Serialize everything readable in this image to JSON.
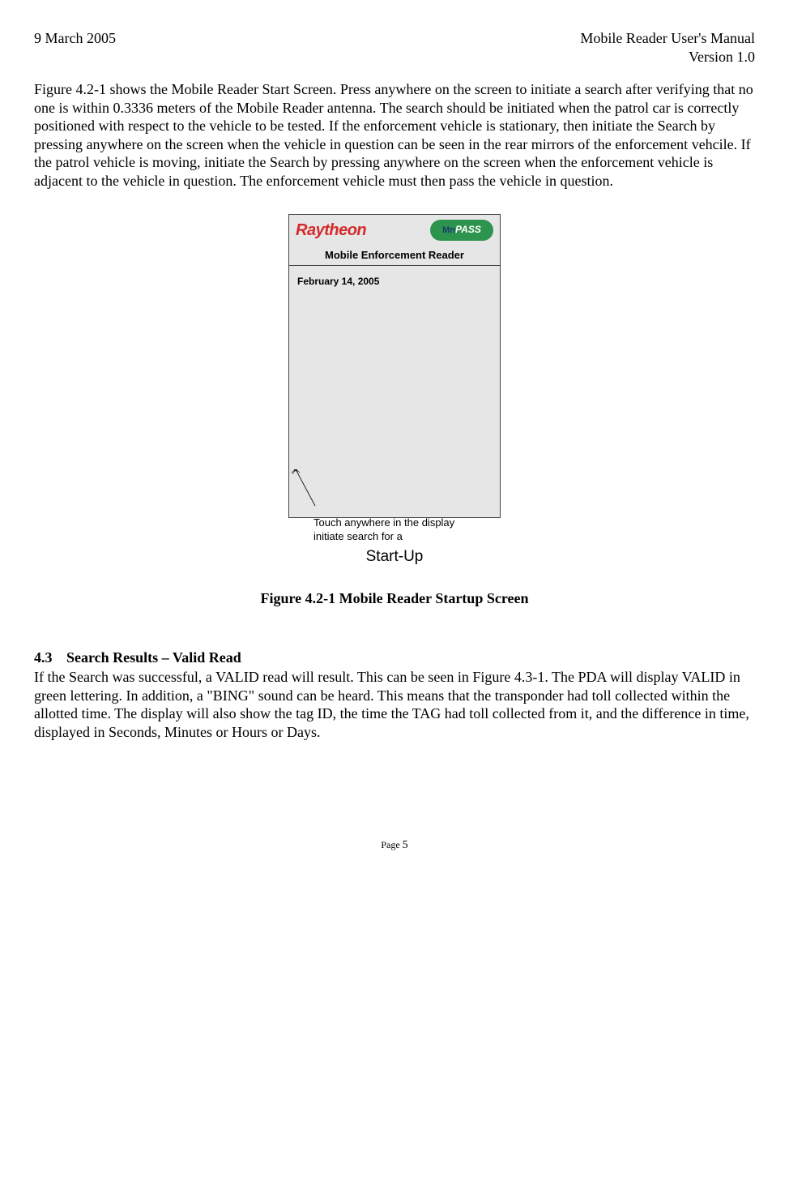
{
  "header": {
    "left": "9 March 2005",
    "right1": "Mobile Reader User's Manual",
    "right2": "Version 1.0"
  },
  "para1": "Figure 4.2-1 shows the Mobile Reader Start Screen.  Press anywhere on the screen to initiate a search after verifying that no one is within 0.3336 meters of the Mobile Reader antenna.  The search should be initiated when the patrol car is correctly positioned with respect to the vehicle to be tested.  If the enforcement vehicle is stationary, then initiate the Search by pressing anywhere on the screen when the vehicle in question can be seen in the rear mirrors of the enforcement vehcile.  If the patrol vehicle is moving, initiate the Search by pressing anywhere on the screen when the enforcement vehicle is adjacent to the vehicle in question.  The enforcement vehicle must then pass the vehicle in question.",
  "screen": {
    "logo_raytheon": "Raytheon",
    "logo_mn": "Mn",
    "logo_pass": "PASS",
    "subtitle": "Mobile Enforcement Reader",
    "date": "February 14, 2005"
  },
  "callout": {
    "line1": "Touch anywhere in the display",
    "line2": "initiate search for a"
  },
  "startup_label": "Start-Up",
  "fig_caption": "Figure 4.2-1 Mobile Reader Startup Screen",
  "section": {
    "num": "4.3",
    "title": "Search Results – Valid Read"
  },
  "para2": "If the Search was successful, a VALID read will result.  This can be seen in Figure 4.3-1.  The PDA will display VALID in green lettering.  In addition, a \"BING\" sound can be heard.  This means that the transponder had toll collected within the allotted time.  The display will also show the tag ID, the time the TAG had toll collected from it, and the difference in time, displayed in Seconds, Minutes or Hours or Days.",
  "footer": {
    "prefix": "Page ",
    "num": "5"
  }
}
